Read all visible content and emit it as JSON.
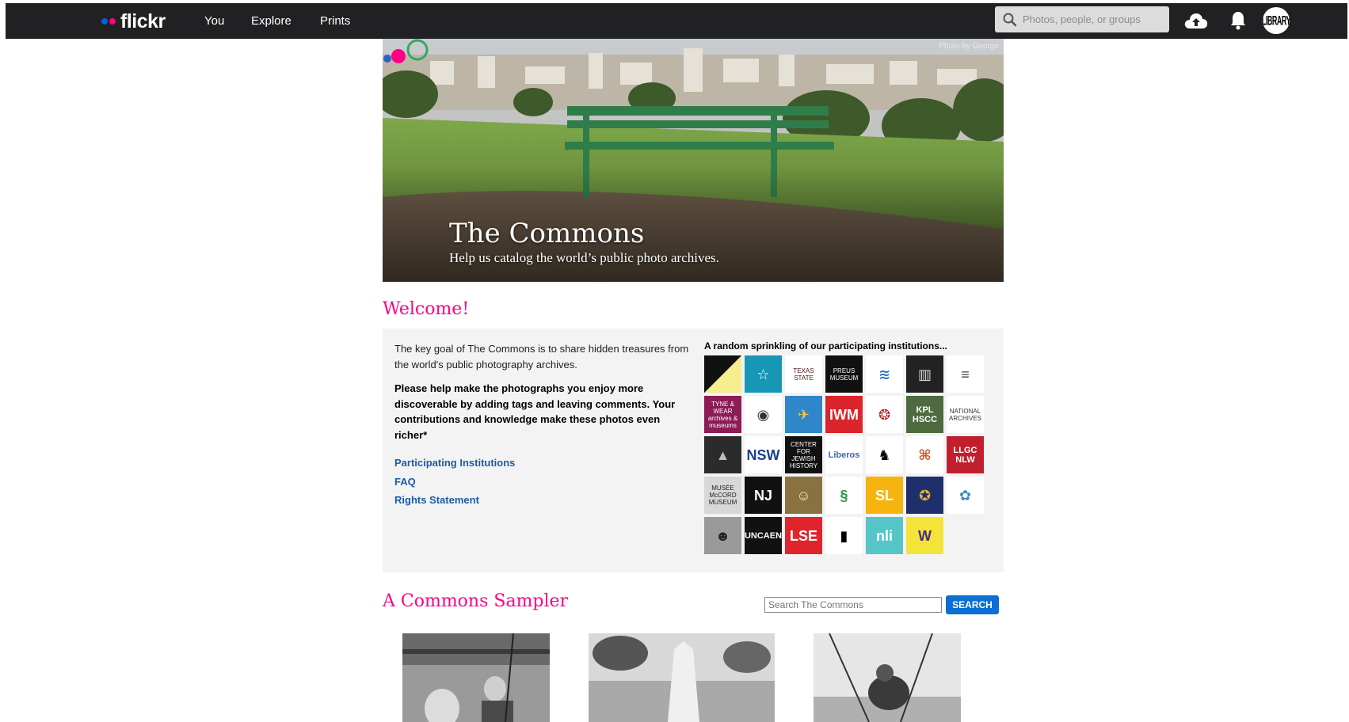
{
  "header": {
    "logo_text": "flickr",
    "nav": [
      {
        "label": "You"
      },
      {
        "label": "Explore"
      },
      {
        "label": "Prints"
      }
    ],
    "search_placeholder": "Photos, people, or groups",
    "icons": [
      "upload-cloud-icon",
      "notification-bell-icon"
    ],
    "avatar_text": "LIBRARY"
  },
  "hero": {
    "photo_credit": "Photo by George",
    "title": "The Commons",
    "subtitle": "Help us catalog the world’s public photo archives."
  },
  "welcome": {
    "heading": "Welcome!",
    "intro": "The key goal of The Commons is to share hidden treasures from the world's public photography archives.",
    "call_to_action": "Please help make the photographs you enjoy more discoverable by adding tags and leaving comments. Your contributions and knowledge make these photos even richer*",
    "links": [
      {
        "label": "Participating Institutions"
      },
      {
        "label": "FAQ"
      },
      {
        "label": "Rights Statement"
      }
    ],
    "institutions_heading": "A random sprinkling of our participating institutions...",
    "institutions": [
      {
        "text": "",
        "bg": "#f6ee8c",
        "fg": "#000",
        "style": "diag"
      },
      {
        "text": "☆",
        "bg": "#1796b5",
        "fg": "#fff"
      },
      {
        "text": "TEXAS STATE",
        "bg": "#ffffff",
        "fg": "#501214"
      },
      {
        "text": "PREUS MUSEUM",
        "bg": "#111111",
        "fg": "#fff"
      },
      {
        "text": "≋",
        "bg": "#ffffff",
        "fg": "#2e79c6"
      },
      {
        "text": "▥",
        "bg": "#222222",
        "fg": "#ddd"
      },
      {
        "text": "≡",
        "bg": "#ffffff",
        "fg": "#444"
      },
      {
        "text": "TYNE & WEAR archives & museums",
        "bg": "#8c1b56",
        "fg": "#fff"
      },
      {
        "text": "◉",
        "bg": "#ffffff",
        "fg": "#333"
      },
      {
        "text": "✈",
        "bg": "#2f86c9",
        "fg": "#f2c74a"
      },
      {
        "text": "IWM",
        "bg": "#d9252b",
        "fg": "#fff"
      },
      {
        "text": "❂",
        "bg": "#ffffff",
        "fg": "#b3242c"
      },
      {
        "text": "KPL HSCC",
        "bg": "#4d6b3e",
        "fg": "#fff"
      },
      {
        "text": "NATIONAL ARCHIVES",
        "bg": "#ffffff",
        "fg": "#333"
      },
      {
        "text": "▲",
        "bg": "#2b2b2b",
        "fg": "#bbb"
      },
      {
        "text": "NSW",
        "bg": "#ffffff",
        "fg": "#1b3f8f"
      },
      {
        "text": "CENTER FOR JEWISH HISTORY",
        "bg": "#111111",
        "fg": "#fff"
      },
      {
        "text": "Liberos",
        "bg": "#ffffff",
        "fg": "#3a66a8"
      },
      {
        "text": "♞",
        "bg": "#ffffff",
        "fg": "#000"
      },
      {
        "text": "⌘",
        "bg": "#ffffff",
        "fg": "#d8542a"
      },
      {
        "text": "LLGC NLW",
        "bg": "#c0202e",
        "fg": "#fff"
      },
      {
        "text": "MUSÉE McCORD MUSEUM",
        "bg": "#d8d8d8",
        "fg": "#222"
      },
      {
        "text": "NJ",
        "bg": "#111111",
        "fg": "#fff"
      },
      {
        "text": "☺",
        "bg": "#8a7240",
        "fg": "#f3e6c4"
      },
      {
        "text": "§",
        "bg": "#ffffff",
        "fg": "#2a9a3e"
      },
      {
        "text": "SL",
        "bg": "#f6b40f",
        "fg": "#fff"
      },
      {
        "text": "✪",
        "bg": "#1f2f6b",
        "fg": "#e0b13a"
      },
      {
        "text": "✿",
        "bg": "#ffffff",
        "fg": "#3a8fbd"
      },
      {
        "text": "☻",
        "bg": "#9a9a9a",
        "fg": "#222"
      },
      {
        "text": "UNCAEN",
        "bg": "#111111",
        "fg": "#fff"
      },
      {
        "text": "LSE",
        "bg": "#e0242c",
        "fg": "#fff"
      },
      {
        "text": "▮",
        "bg": "#ffffff",
        "fg": "#000"
      },
      {
        "text": "nli",
        "bg": "#55c5c8",
        "fg": "#fff"
      },
      {
        "text": "W",
        "bg": "#f4e43a",
        "fg": "#4b2a85"
      }
    ]
  },
  "sampler": {
    "heading": "A Commons Sampler",
    "search_placeholder": "Search The Commons",
    "search_button": "SEARCH"
  }
}
